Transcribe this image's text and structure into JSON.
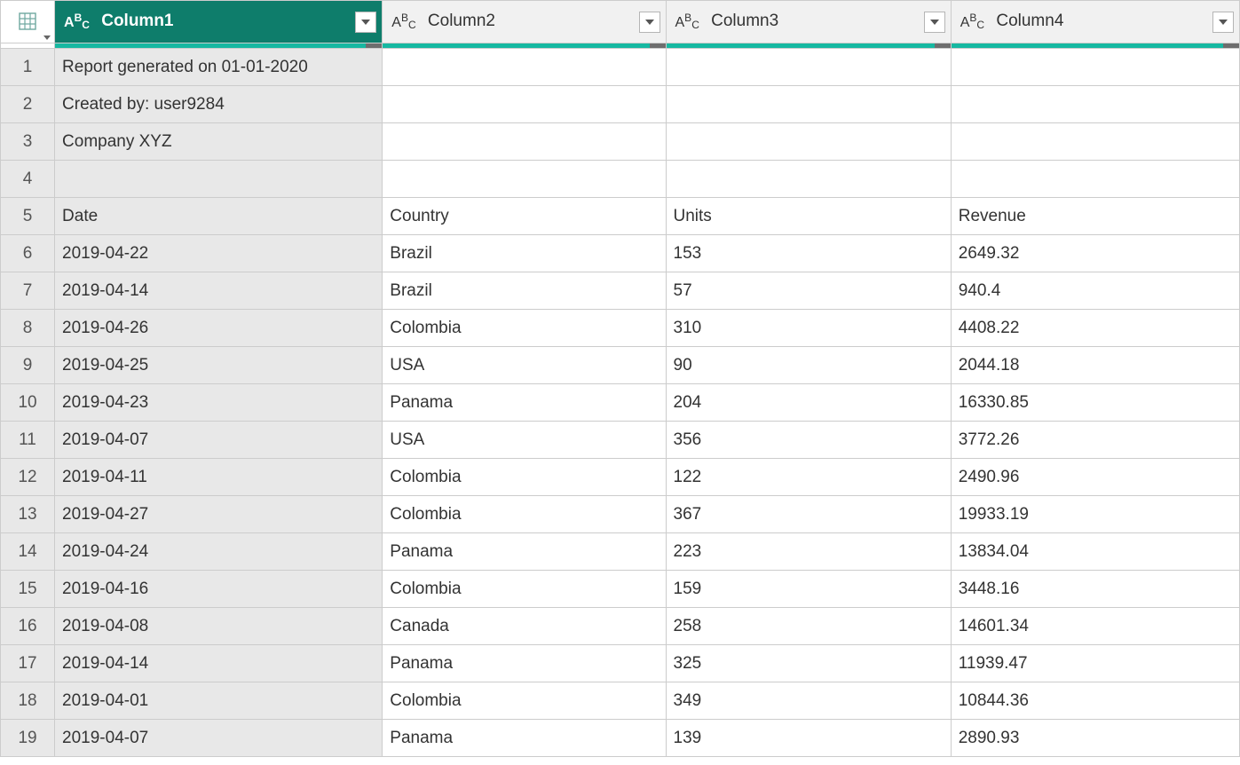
{
  "columns": [
    {
      "name": "Column1",
      "type_badge": "ABC",
      "selected": true
    },
    {
      "name": "Column2",
      "type_badge": "ABC",
      "selected": false
    },
    {
      "name": "Column3",
      "type_badge": "ABC",
      "selected": false
    },
    {
      "name": "Column4",
      "type_badge": "ABC",
      "selected": false
    }
  ],
  "rows": [
    {
      "n": "1",
      "c1": "Report generated on 01-01-2020",
      "c2": "",
      "c3": "",
      "c4": ""
    },
    {
      "n": "2",
      "c1": "Created by: user9284",
      "c2": "",
      "c3": "",
      "c4": ""
    },
    {
      "n": "3",
      "c1": "Company XYZ",
      "c2": "",
      "c3": "",
      "c4": ""
    },
    {
      "n": "4",
      "c1": "",
      "c2": "",
      "c3": "",
      "c4": ""
    },
    {
      "n": "5",
      "c1": "Date",
      "c2": "Country",
      "c3": "Units",
      "c4": "Revenue"
    },
    {
      "n": "6",
      "c1": "2019-04-22",
      "c2": "Brazil",
      "c3": "153",
      "c4": "2649.32"
    },
    {
      "n": "7",
      "c1": "2019-04-14",
      "c2": "Brazil",
      "c3": "57",
      "c4": "940.4"
    },
    {
      "n": "8",
      "c1": "2019-04-26",
      "c2": "Colombia",
      "c3": "310",
      "c4": "4408.22"
    },
    {
      "n": "9",
      "c1": "2019-04-25",
      "c2": "USA",
      "c3": "90",
      "c4": "2044.18"
    },
    {
      "n": "10",
      "c1": "2019-04-23",
      "c2": "Panama",
      "c3": "204",
      "c4": "16330.85"
    },
    {
      "n": "11",
      "c1": "2019-04-07",
      "c2": "USA",
      "c3": "356",
      "c4": "3772.26"
    },
    {
      "n": "12",
      "c1": "2019-04-11",
      "c2": "Colombia",
      "c3": "122",
      "c4": "2490.96"
    },
    {
      "n": "13",
      "c1": "2019-04-27",
      "c2": "Colombia",
      "c3": "367",
      "c4": "19933.19"
    },
    {
      "n": "14",
      "c1": "2019-04-24",
      "c2": "Panama",
      "c3": "223",
      "c4": "13834.04"
    },
    {
      "n": "15",
      "c1": "2019-04-16",
      "c2": "Colombia",
      "c3": "159",
      "c4": "3448.16"
    },
    {
      "n": "16",
      "c1": "2019-04-08",
      "c2": "Canada",
      "c3": "258",
      "c4": "14601.34"
    },
    {
      "n": "17",
      "c1": "2019-04-14",
      "c2": "Panama",
      "c3": "325",
      "c4": "11939.47"
    },
    {
      "n": "18",
      "c1": "2019-04-01",
      "c2": "Colombia",
      "c3": "349",
      "c4": "10844.36"
    },
    {
      "n": "19",
      "c1": "2019-04-07",
      "c2": "Panama",
      "c3": "139",
      "c4": "2890.93"
    }
  ]
}
